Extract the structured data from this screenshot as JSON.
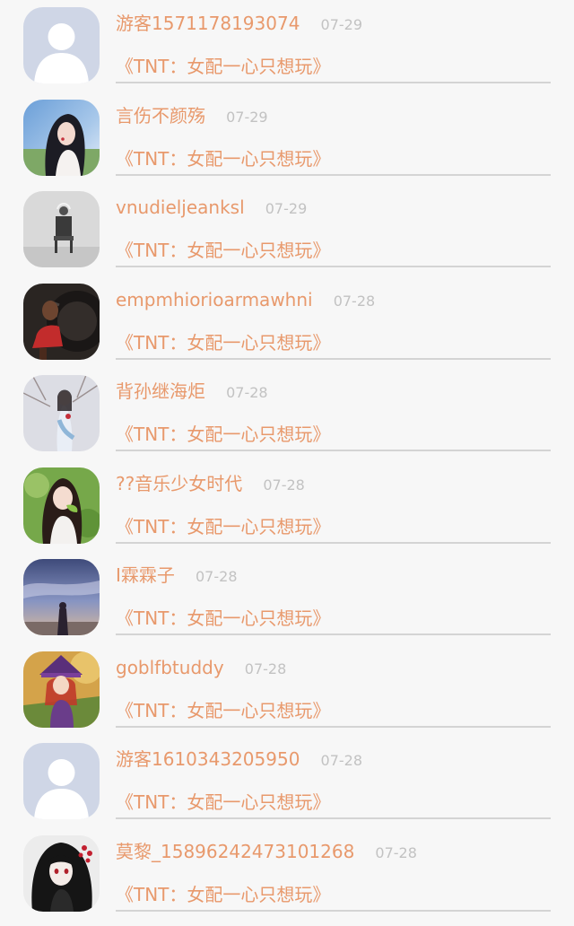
{
  "comments": [
    {
      "name": "游客1571178193074",
      "date": "07-29",
      "book": "《TNT：女配一心只想玩》",
      "avatar": "default-avatar"
    },
    {
      "name": "言伤不颜殇",
      "date": "07-29",
      "book": "《TNT：女配一心只想玩》",
      "avatar": "girl-photo-avatar"
    },
    {
      "name": "vnudieljeanksl",
      "date": "07-29",
      "book": "《TNT：女配一心只想玩》",
      "avatar": "chair-photo-avatar"
    },
    {
      "name": "empmhiorioarmawhni",
      "date": "07-28",
      "book": "《TNT：女配一心只想玩》",
      "avatar": "tire-photo-avatar"
    },
    {
      "name": "背孙继海炬",
      "date": "07-28",
      "book": "《TNT：女配一心只想玩》",
      "avatar": "winter-girl-avatar"
    },
    {
      "name": "??音乐少女时代",
      "date": "07-28",
      "book": "《TNT：女配一心只想玩》",
      "avatar": "green-girl-avatar"
    },
    {
      "name": "I霖霖子",
      "date": "07-28",
      "book": "《TNT：女配一心只想玩》",
      "avatar": "sky-scene-avatar"
    },
    {
      "name": "goblfbtuddy",
      "date": "07-28",
      "book": "《TNT：女配一心只想玩》",
      "avatar": "anime-witch-avatar"
    },
    {
      "name": "游客1610343205950",
      "date": "07-28",
      "book": "《TNT：女配一心只想玩》",
      "avatar": "default-avatar"
    },
    {
      "name": "莫黎_15896242473101268",
      "date": "07-28",
      "book": "《TNT：女配一心只想玩》",
      "avatar": "anime-dark-avatar"
    }
  ],
  "colors": {
    "accent": "#e8996c",
    "date": "#c2c2c2",
    "divider": "#d4d4d4",
    "background": "#f7f7f7"
  }
}
